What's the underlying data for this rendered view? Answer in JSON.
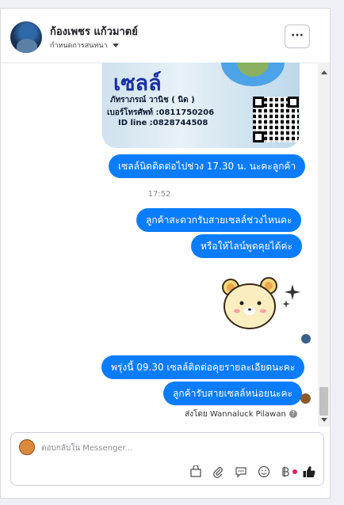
{
  "header": {
    "name": "ก้องเพชร แก้วมาตย์",
    "subtitle": "กำหนดการสนทนา",
    "more_label": "···"
  },
  "promo_card": {
    "big_text": "เซลล์",
    "lines": [
      "ภัทราภรณ์ วานิช ( นิด )",
      "เบอร์โทรศัพท์ :0811750206",
      "ID line :0828744508"
    ]
  },
  "messages": [
    {
      "text": "เซลล์นิดติดต่อไปช่วง 17.30 น. นะคะลูกค้า"
    },
    {
      "text": "ลูกค้าสะดวกรับสายเซลล์ช่วงไหนคะ"
    },
    {
      "text": "หรือให้ไลน์พูดคุยได้ค่ะ"
    },
    {
      "text": "พรุ่งนี้ 09.30 เซลล์ติดต่อคุยรายละเอียดนะคะ"
    },
    {
      "text": "ลูกค้ารับสายเซลล์หน่อยนะคะ"
    }
  ],
  "timestamp": "17:52",
  "sent_by": {
    "prefix": "ส่งโดย",
    "name": "Wannaluck Pilawan",
    "info_icon": "?"
  },
  "composer": {
    "placeholder": "ตอบกลับใน Messenger..."
  },
  "colors": {
    "bubble": "#0a7cff",
    "like": "#1c1e21"
  }
}
